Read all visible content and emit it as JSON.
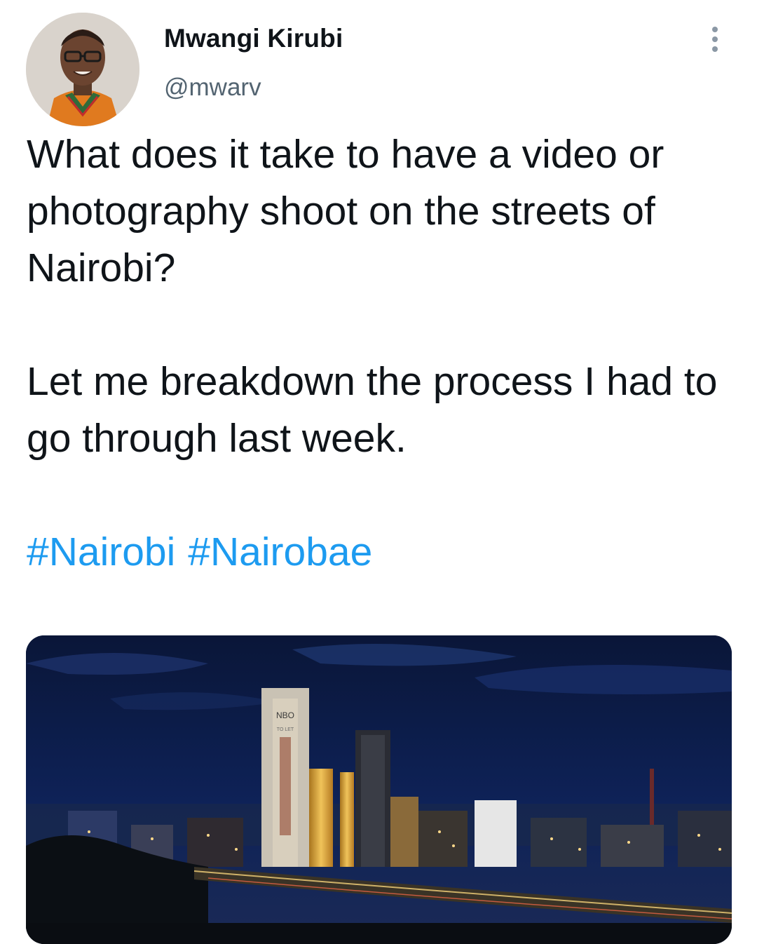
{
  "author": {
    "name": "Mwangi Kirubi",
    "handle": "@mwarv",
    "avatar_icon": "profile-photo"
  },
  "more_icon": "more-vertical-icon",
  "tweet": {
    "paragraph_1": "What does it take to have a video or photography shoot on the streets of Nairobi?",
    "paragraph_2": "Let me breakdown the process I had to go through last week.",
    "hashtags": [
      "#Nairobi",
      "#Nairobae"
    ]
  },
  "media": {
    "tower_sign": "NBO",
    "tower_sign_sub": "TO LET"
  },
  "colors": {
    "text": "#0f1419",
    "secondary": "#536471",
    "link": "#1d9bf0",
    "night_sky": "#0b1a4a"
  }
}
